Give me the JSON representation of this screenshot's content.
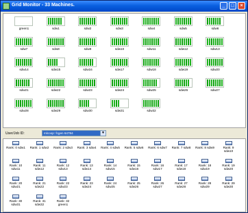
{
  "window": {
    "title": "Grid Monitor - 33 Machines.",
    "minimize_label": "_",
    "maximize_label": "□",
    "close_label": "×"
  },
  "colors": {
    "host_bar": "#1fb21f",
    "host_bar_alt": "#0e9f0e",
    "selection": "#316ac5",
    "titlebar": "#0a5fe0"
  },
  "hosts": [
    {
      "label": "green1",
      "load": 0
    },
    {
      "label": "sdw1",
      "load": 0.8
    },
    {
      "label": "sdw2",
      "load": 0.8
    },
    {
      "label": "sdw3",
      "load": 0.8
    },
    {
      "label": "sdw4",
      "load": 0.9
    },
    {
      "label": "sdw5",
      "load": 0.8
    },
    {
      "label": "sdw6",
      "load": 0.8
    },
    {
      "label": "sdw7",
      "load": 0.9
    },
    {
      "label": "sdw8",
      "load": 0.8
    },
    {
      "label": "sdw9",
      "load": 0.8
    },
    {
      "label": "sdw10",
      "load": 0.8
    },
    {
      "label": "sdw11",
      "load": 0.9
    },
    {
      "label": "sdw12",
      "load": 0.8
    },
    {
      "label": "sdw13",
      "load": 0.8
    },
    {
      "label": "sdw14",
      "load": 0.9
    },
    {
      "label": "sdw15",
      "load": 0.6
    },
    {
      "label": "sdw16",
      "load": 0.8
    },
    {
      "label": "sdw17",
      "load": 0.9
    },
    {
      "label": "sdw18",
      "load": 0.9
    },
    {
      "label": "sdw19",
      "load": 0.8
    },
    {
      "label": "sdw20",
      "load": 0.8
    },
    {
      "label": "sdw21",
      "load": 0.8
    },
    {
      "label": "sdw22",
      "load": 0.8
    },
    {
      "label": "sdw23",
      "load": 0.8
    },
    {
      "label": "sdw24",
      "load": 0.8
    },
    {
      "label": "sdw25",
      "load": 0.7
    },
    {
      "label": "sdw26",
      "load": 0.8
    },
    {
      "label": "sdw27",
      "load": 0.9
    },
    {
      "label": "sdw28",
      "load": 0.8
    },
    {
      "label": "sdw29",
      "load": 0.8
    },
    {
      "label": "sdw30",
      "load": 0.6
    },
    {
      "label": "sdw31",
      "load": 0.3
    },
    {
      "label": "sdw32",
      "load": 0.8
    }
  ],
  "job_selector": {
    "label": "User/Job ID:",
    "value": "mlcoop: fcgen 64784",
    "arrow": "▼"
  },
  "ranks": [
    {
      "rank": "Rank: 0",
      "host": "sdw1"
    },
    {
      "rank": "Rank: 1",
      "host": "sdw2"
    },
    {
      "rank": "Rank: 2",
      "host": "sdw3"
    },
    {
      "rank": "Rank: 3",
      "host": "sdw4"
    },
    {
      "rank": "Rank: 4",
      "host": "sdw5"
    },
    {
      "rank": "Rank: 5",
      "host": "sdw6"
    },
    {
      "rank": "Rank: 6",
      "host": "sdw7"
    },
    {
      "rank": "Rank: 7",
      "host": "sdw8"
    },
    {
      "rank": "Rank: 8",
      "host": "sdw9"
    },
    {
      "rank": "Rank: 9",
      "host": "sdw10"
    },
    {
      "rank": "Rank: 10",
      "host": "sdw11"
    },
    {
      "rank": "Rank: 11",
      "host": "sdw12"
    },
    {
      "rank": "Rank: 12",
      "host": "sdw13"
    },
    {
      "rank": "Rank: 13",
      "host": "sdw14"
    },
    {
      "rank": "Rank: 14",
      "host": "sdw15"
    },
    {
      "rank": "Rank: 15",
      "host": "sdw16"
    },
    {
      "rank": "Rank: 16",
      "host": "sdw17"
    },
    {
      "rank": "Rank: 17",
      "host": "sdw18"
    },
    {
      "rank": "Rank: 18",
      "host": "sdw19"
    },
    {
      "rank": "Rank: 19",
      "host": "sdw20"
    },
    {
      "rank": "Rank: 20",
      "host": "sdw21"
    },
    {
      "rank": "Rank: 21",
      "host": "sdw22"
    },
    {
      "rank": "Rank: 22",
      "host": "sdw23"
    },
    {
      "rank": "Rank: 23",
      "host": "sdw24"
    },
    {
      "rank": "Rank: 24",
      "host": "sdw25"
    },
    {
      "rank": "Rank: 25",
      "host": "sdw26"
    },
    {
      "rank": "Rank: 26",
      "host": "sdw27"
    },
    {
      "rank": "Rank: 27",
      "host": "sdw28"
    },
    {
      "rank": "Rank: 28",
      "host": "sdw29"
    },
    {
      "rank": "Rank: 29",
      "host": "sdw30"
    },
    {
      "rank": "Rank: 30",
      "host": "sdw31"
    },
    {
      "rank": "Rank: 31",
      "host": "sdw32"
    },
    {
      "rank": "Rank: 32",
      "host": "green1"
    }
  ]
}
